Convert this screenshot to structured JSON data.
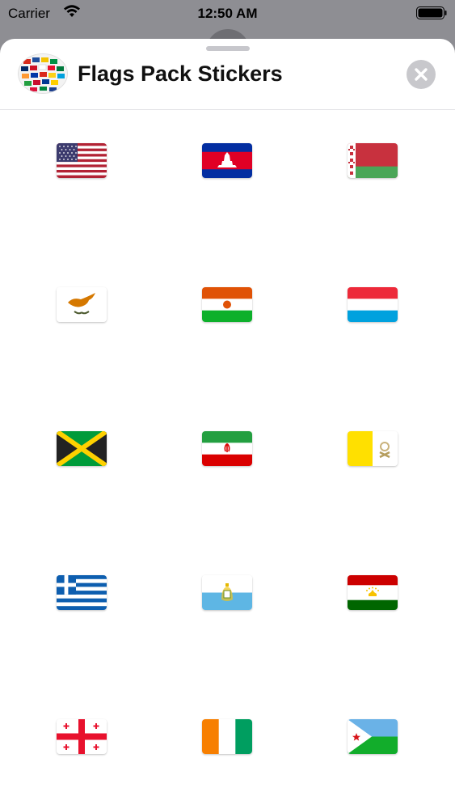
{
  "status_bar": {
    "carrier": "Carrier",
    "time": "12:50 AM"
  },
  "header": {
    "title": "Flags Pack Stickers"
  },
  "stickers": [
    {
      "country": "United States"
    },
    {
      "country": "Cambodia"
    },
    {
      "country": "Belarus"
    },
    {
      "country": "Cyprus"
    },
    {
      "country": "Niger"
    },
    {
      "country": "Luxembourg"
    },
    {
      "country": "Jamaica"
    },
    {
      "country": "Iran"
    },
    {
      "country": "Vatican City"
    },
    {
      "country": "Greece"
    },
    {
      "country": "San Marino"
    },
    {
      "country": "Tajikistan"
    },
    {
      "country": "Georgia"
    },
    {
      "country": "Ivory Coast"
    },
    {
      "country": "Djibouti"
    }
  ],
  "colors": {
    "sheet_bg": "#ffffff",
    "backdrop": "#8e8e93",
    "close_button": "#c8c8cc"
  }
}
